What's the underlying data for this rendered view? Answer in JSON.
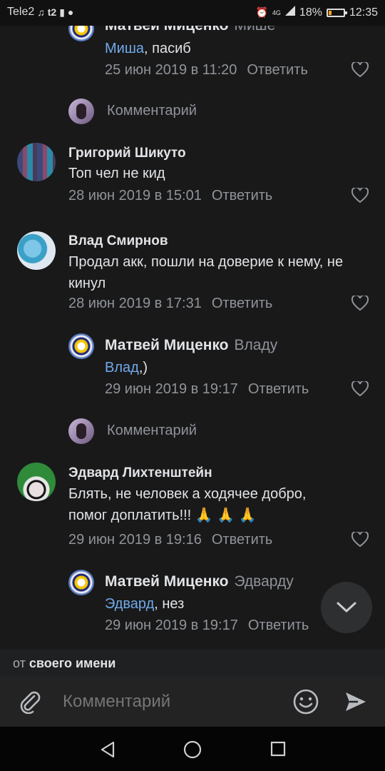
{
  "status_bar": {
    "carrier": "Tele2",
    "network": "4G",
    "battery": "18%",
    "battery_level": 0.18,
    "time": "12:35"
  },
  "comments": [
    {
      "author": "Матвей Миценко",
      "reply_to": "Мише",
      "mention": "Миша",
      "text": ", пасиб",
      "date": "25 июн 2019 в 11:20",
      "reply_label": "Ответить",
      "avatar_icon": "target-avatar"
    },
    {
      "author": "Григорий Шикуто",
      "text": "Топ чел не кид",
      "date": "28 июн 2019 в 15:01",
      "reply_label": "Ответить"
    },
    {
      "author": "Влад Смирнов",
      "text": "Продал акк, пошли на доверие к нему, не кинул",
      "date": "28 июн 2019 в 17:31",
      "reply_label": "Ответить"
    },
    {
      "author": "Матвей Миценко",
      "reply_to": "Владу",
      "mention": "Влад",
      "text": ",)",
      "date": "29 июн 2019 в 19:17",
      "reply_label": "Ответить"
    },
    {
      "author": "Эдвард Лихтенштейн",
      "text_line1": "Блять, не человек а ходячее добро,",
      "text_line2": "помог доплатить!!!",
      "emoji": "🙏 🙏 🙏",
      "date": "29 июн 2019 в 19:16",
      "reply_label": "Ответить"
    },
    {
      "author": "Матвей Миценко",
      "reply_to": "Эдварду",
      "mention": "Эдвард",
      "text": ", нез",
      "date": "29 июн 2019 в 19:17",
      "reply_label": "Ответить"
    }
  ],
  "thread_reply_prompt": "Комментарий",
  "from_name": {
    "prefix": "от",
    "value": "своего имени"
  },
  "composer": {
    "placeholder": "Комментарий"
  },
  "colors": {
    "background": "#19191a",
    "link": "#71aaeb",
    "secondary": "#909499"
  }
}
